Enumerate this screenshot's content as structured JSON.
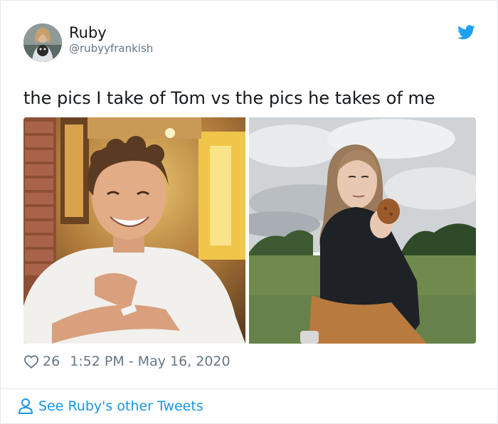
{
  "author": {
    "name": "Ruby",
    "handle": "@rubyyfrankish"
  },
  "tweet": {
    "text": "the pics I take of Tom vs the pics he takes of me",
    "likes": "26",
    "timestamp": "1:52 PM - May 16, 2020"
  },
  "footer": {
    "link_label": "See Ruby's other Tweets"
  },
  "icons": {
    "brand": "twitter-bird-icon",
    "like": "heart-outline-icon",
    "profile": "person-icon"
  },
  "colors": {
    "twitter_blue": "#1da1f2",
    "link_blue": "#1b95e0",
    "text_primary": "#14171a",
    "text_secondary": "#657786",
    "border": "#e1e8ed"
  }
}
